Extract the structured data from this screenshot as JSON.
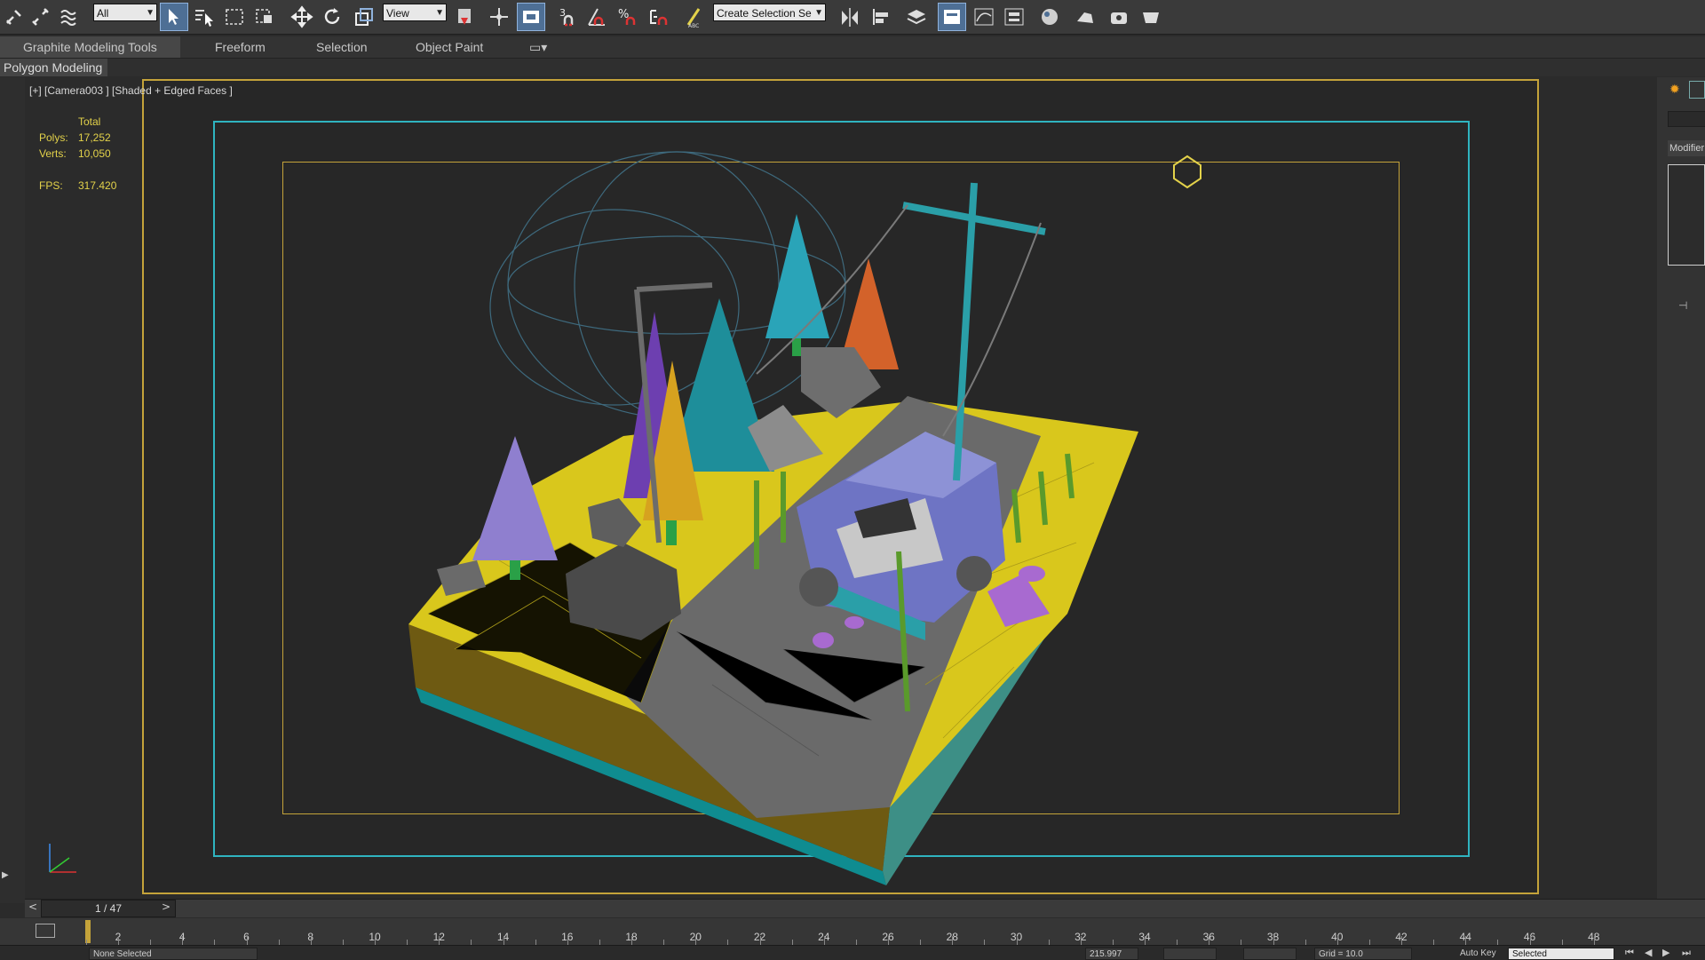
{
  "toolbar": {
    "selection_filter": "All",
    "reference_coord": "View",
    "named_selection": "Create Selection Se",
    "icons": [
      "link-icon",
      "unlink-icon",
      "bind-space-warp-icon",
      "select-object-icon",
      "select-by-name-icon",
      "rect-region-icon",
      "window-crossing-icon",
      "move-icon",
      "rotate-icon",
      "scale-icon",
      "select-manipulate-icon",
      "use-pivot-center-icon",
      "keyboard-shortcut-toggle-icon",
      "snap-3d-icon",
      "angle-snap-icon",
      "percent-snap-icon",
      "spinner-snap-icon",
      "edit-named-sets-icon",
      "mirror-icon",
      "align-icon",
      "layer-explorer-icon",
      "scene-explorer-icon",
      "curve-editor-icon",
      "schematic-view-icon",
      "material-editor-icon",
      "render-setup-icon",
      "rendered-frame-icon",
      "render-icon"
    ]
  },
  "ribbon": {
    "tabs": [
      "Graphite Modeling Tools",
      "Freeform",
      "Selection",
      "Object Paint"
    ],
    "panel_label": "Polygon Modeling"
  },
  "viewport": {
    "label": "[+] [Camera003 ] [Shaded + Edged Faces ]",
    "stats": {
      "header": "Total",
      "polys_label": "Polys:",
      "polys_value": "17,252",
      "verts_label": "Verts:",
      "verts_value": "10,050",
      "fps_label": "FPS:",
      "fps_value": "317.420"
    }
  },
  "right_panel": {
    "modifier_label": "Modifier"
  },
  "timeline": {
    "frame_counter": "1 / 47",
    "prev": "<",
    "next": ">",
    "ticks": [
      "2",
      "4",
      "6",
      "8",
      "10",
      "12",
      "14",
      "16",
      "18",
      "20",
      "22",
      "24",
      "26",
      "28",
      "30",
      "32",
      "34",
      "36",
      "38",
      "40",
      "42",
      "44",
      "46",
      "48"
    ]
  },
  "status": {
    "selection": "None Selected",
    "x_value": "215.997",
    "grid": "Grid = 10.0",
    "auto_key": "Auto Key",
    "key_mode": "Selected"
  },
  "colors": {
    "viewport_frame": "#c4a33a",
    "safe_frame": "#2fb4c0",
    "ground": "#d9c71c",
    "road": "#6a6a6a",
    "car": "#6e74c4"
  }
}
